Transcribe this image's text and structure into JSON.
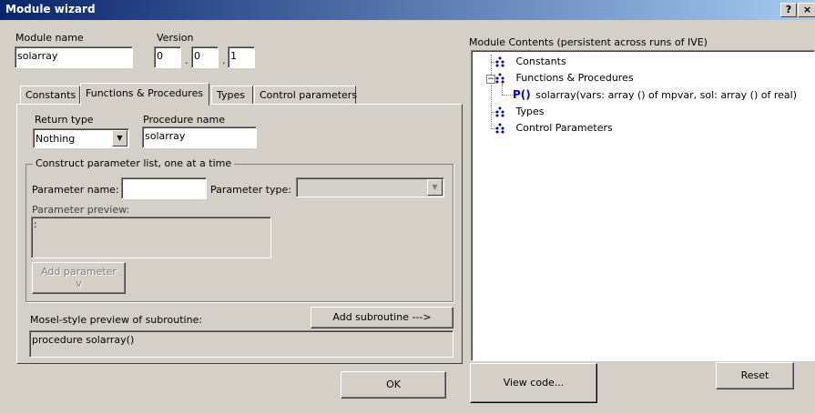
{
  "window": {
    "title": "Module wizard",
    "help_glyph": "?",
    "close_glyph": "×"
  },
  "module": {
    "name_label": "Module name",
    "name_value": "solarray",
    "version_label": "Version",
    "version": [
      "0",
      "0",
      "1"
    ],
    "version_sep": "."
  },
  "tabs": [
    {
      "label": "Constants"
    },
    {
      "label": "Functions & Procedures",
      "active": true
    },
    {
      "label": "Types"
    },
    {
      "label": "Control parameters"
    }
  ],
  "proc": {
    "return_type_label": "Return type",
    "return_type_value": "Nothing",
    "procedure_name_label": "Procedure name",
    "procedure_name_value": "solarray"
  },
  "params": {
    "group_caption": "Construct parameter list, one at a time",
    "name_label": "Parameter name:",
    "name_value": "",
    "type_label": "Parameter type:",
    "type_value": "",
    "preview_label": "Parameter preview:",
    "preview_value": ":",
    "add_parameter_label": "Add parameter",
    "add_parameter_arrow": "v"
  },
  "subroutine": {
    "preview_label": "Mosel-style preview of subroutine:",
    "add_label": "Add subroutine --->",
    "preview_value": "procedure solarray()"
  },
  "contents": {
    "label": "Module Contents (persistent across runs of IVE)",
    "tree": [
      {
        "label": "Constants"
      },
      {
        "label": "Functions & Procedures",
        "expanded": true,
        "toggle": "−"
      },
      {
        "label": "solarray(vars: array ()  of mpvar, sol: array ()  of real)",
        "prefix": "P()"
      },
      {
        "label": "Types"
      },
      {
        "label": "Control Parameters"
      }
    ]
  },
  "buttons": {
    "ok": "OK",
    "view_code": "View code...",
    "reset": "Reset"
  },
  "colors": {
    "title_start": "#0a246a",
    "title_end": "#a6caf0",
    "face": "#d4d0c8",
    "icon_blue": "#0000cc"
  }
}
